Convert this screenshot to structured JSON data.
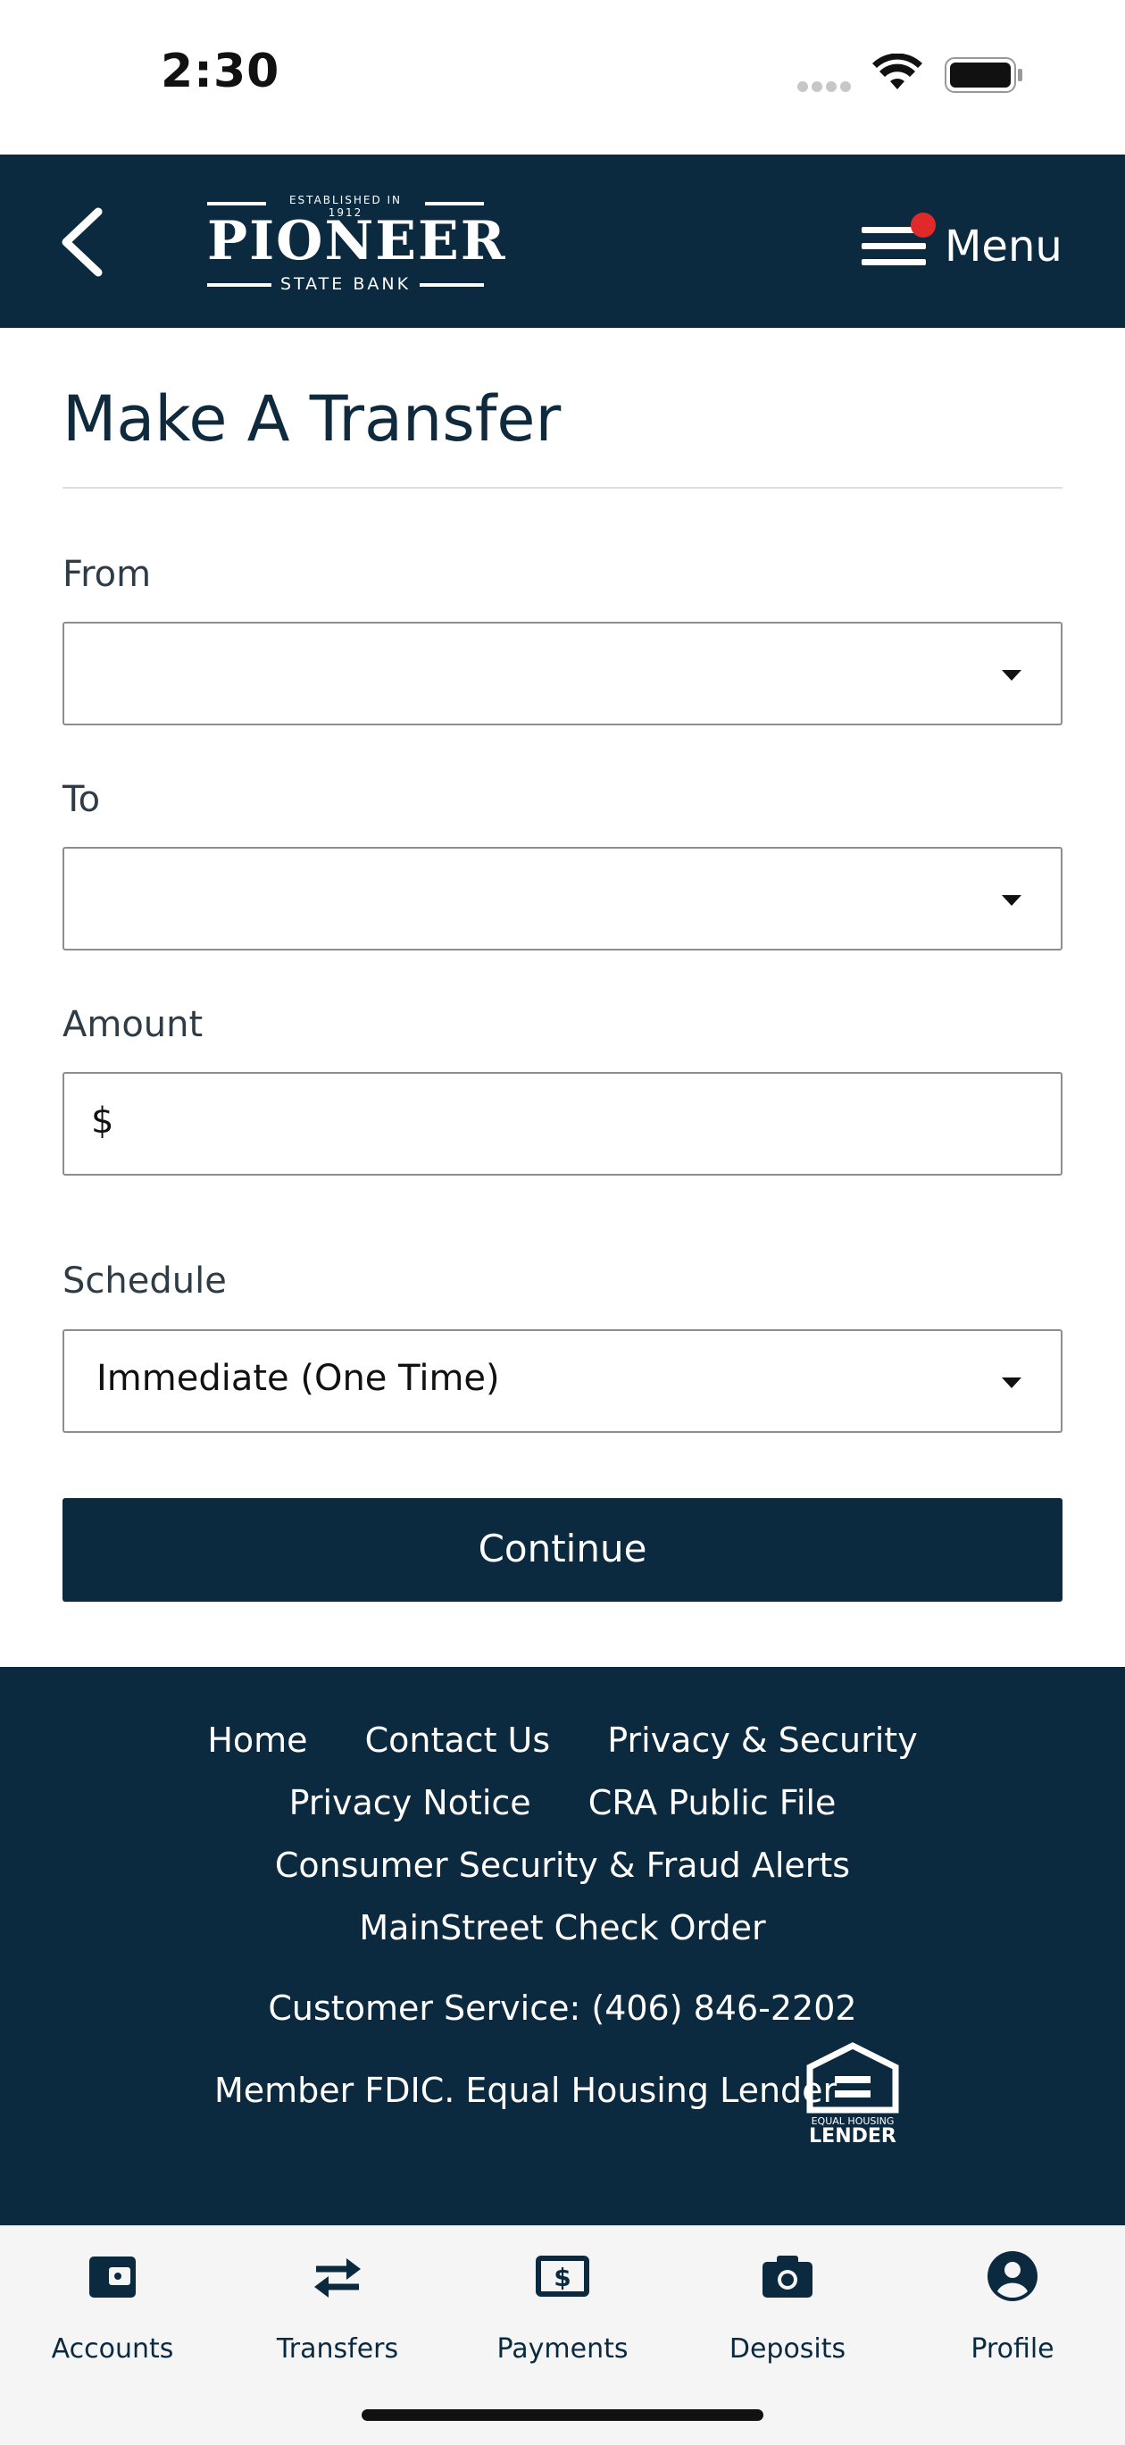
{
  "status_bar": {
    "time": "2:30"
  },
  "header": {
    "logo": {
      "established": "ESTABLISHED IN 1912",
      "name": "PIONEER",
      "subname": "STATE BANK"
    },
    "menu_label": "Menu",
    "back_icon": "chevron-left-icon",
    "menu_icon": "hamburger-icon",
    "notification_color": "#e02a2a"
  },
  "page": {
    "title": "Make A Transfer",
    "from": {
      "label": "From",
      "value": ""
    },
    "to": {
      "label": "To",
      "value": ""
    },
    "amount": {
      "label": "Amount",
      "currency": "$",
      "value": ""
    },
    "schedule": {
      "label": "Schedule",
      "value": "Immediate (One Time)"
    },
    "continue_label": "Continue"
  },
  "footer": {
    "links_row1": [
      "Home",
      "Contact Us",
      "Privacy & Security"
    ],
    "links_row2": [
      "Privacy Notice",
      "CRA Public File"
    ],
    "links_row3": [
      "Consumer Security & Fraud Alerts"
    ],
    "links_row4": [
      "MainStreet Check Order"
    ],
    "customer_service": "Customer Service: (406) 846-2202",
    "fdic": "Member FDIC. Equal Housing Lender",
    "ehl_text_top": "EQUAL HOUSING",
    "ehl_text_bottom": "LENDER"
  },
  "tab_bar": {
    "items": [
      {
        "label": "Accounts",
        "icon": "wallet-icon"
      },
      {
        "label": "Transfers",
        "icon": "transfer-arrows-icon"
      },
      {
        "label": "Payments",
        "icon": "dollar-bill-icon"
      },
      {
        "label": "Deposits",
        "icon": "camera-icon"
      },
      {
        "label": "Profile",
        "icon": "profile-icon"
      }
    ]
  },
  "colors": {
    "brand_navy": "#0b2a40",
    "text": "#0f2a3d",
    "tab_bg": "#f5f5f5"
  }
}
